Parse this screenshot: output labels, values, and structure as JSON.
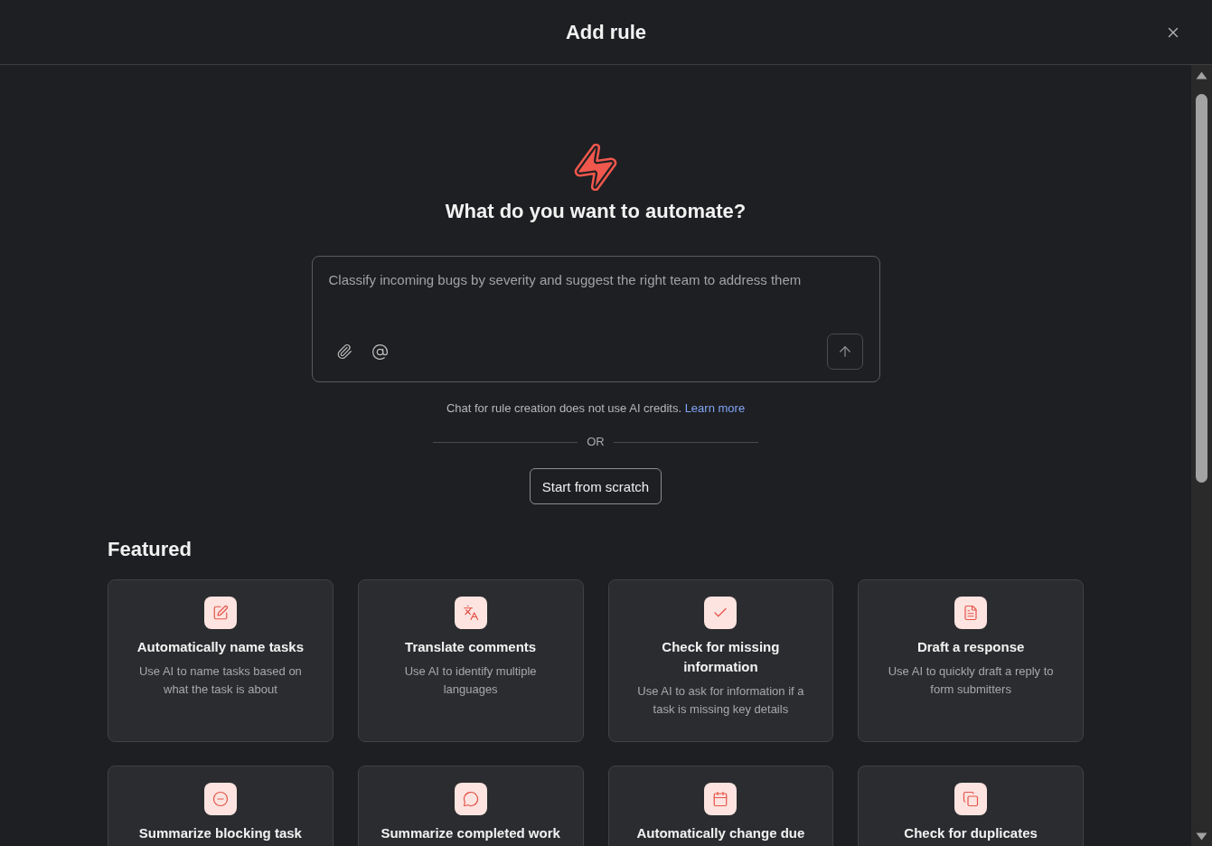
{
  "header": {
    "title": "Add rule"
  },
  "prompt": {
    "heading": "What do you want to automate?",
    "placeholder": "Classify incoming bugs by severity and suggest the right team to address them",
    "note": "Chat for rule creation does not use AI credits.",
    "link": "Learn more"
  },
  "divider": {
    "label": "OR"
  },
  "start_button": {
    "label": "Start from scratch"
  },
  "featured": {
    "title": "Featured",
    "cards": [
      {
        "title": "Automatically name tasks",
        "description": "Use AI to name tasks based on what the task is about"
      },
      {
        "title": "Translate comments",
        "description": "Use AI to identify multiple languages"
      },
      {
        "title": "Check for missing information",
        "description": "Use AI to ask for information if a task is missing key details"
      },
      {
        "title": "Draft a response",
        "description": "Use AI to quickly draft a reply to form submitters"
      },
      {
        "title": "Summarize blocking task"
      },
      {
        "title": "Summarize completed work"
      },
      {
        "title": "Automatically change due"
      },
      {
        "title": "Check for duplicates"
      }
    ]
  }
}
